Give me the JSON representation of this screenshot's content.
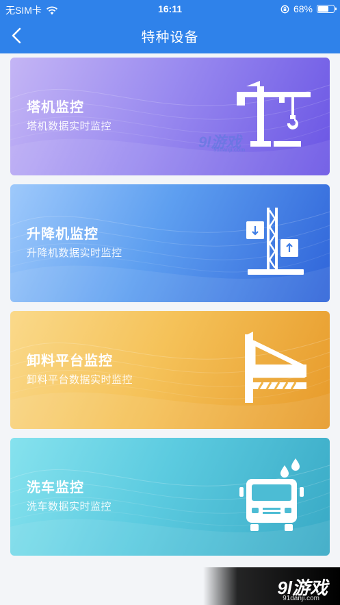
{
  "status_bar": {
    "carrier": "无SIM卡",
    "time": "16:11",
    "battery": "68%",
    "battery_level": 0.68
  },
  "nav": {
    "title": "特种设备"
  },
  "cards": [
    {
      "title": "塔机监控",
      "subtitle": "塔机数据实时监控",
      "icon": "tower-crane-icon"
    },
    {
      "title": "升降机监控",
      "subtitle": "升降机数据实时监控",
      "icon": "elevator-icon"
    },
    {
      "title": "卸料平台监控",
      "subtitle": "卸料平台数据实时监控",
      "icon": "unloading-platform-icon"
    },
    {
      "title": "洗车监控",
      "subtitle": "洗车数据实时监控",
      "icon": "car-wash-icon"
    }
  ],
  "watermark": {
    "brand": "9l游戏",
    "url": "91danji.com"
  },
  "footer": {
    "brand": "9l游戏",
    "url": "91danji.com"
  },
  "colors": {
    "header": "#2f82ea",
    "card_tower": "#7c6be8",
    "card_elevator": "#3f7ee6",
    "card_platform": "#f0b445",
    "card_wash": "#4cbcd4"
  }
}
